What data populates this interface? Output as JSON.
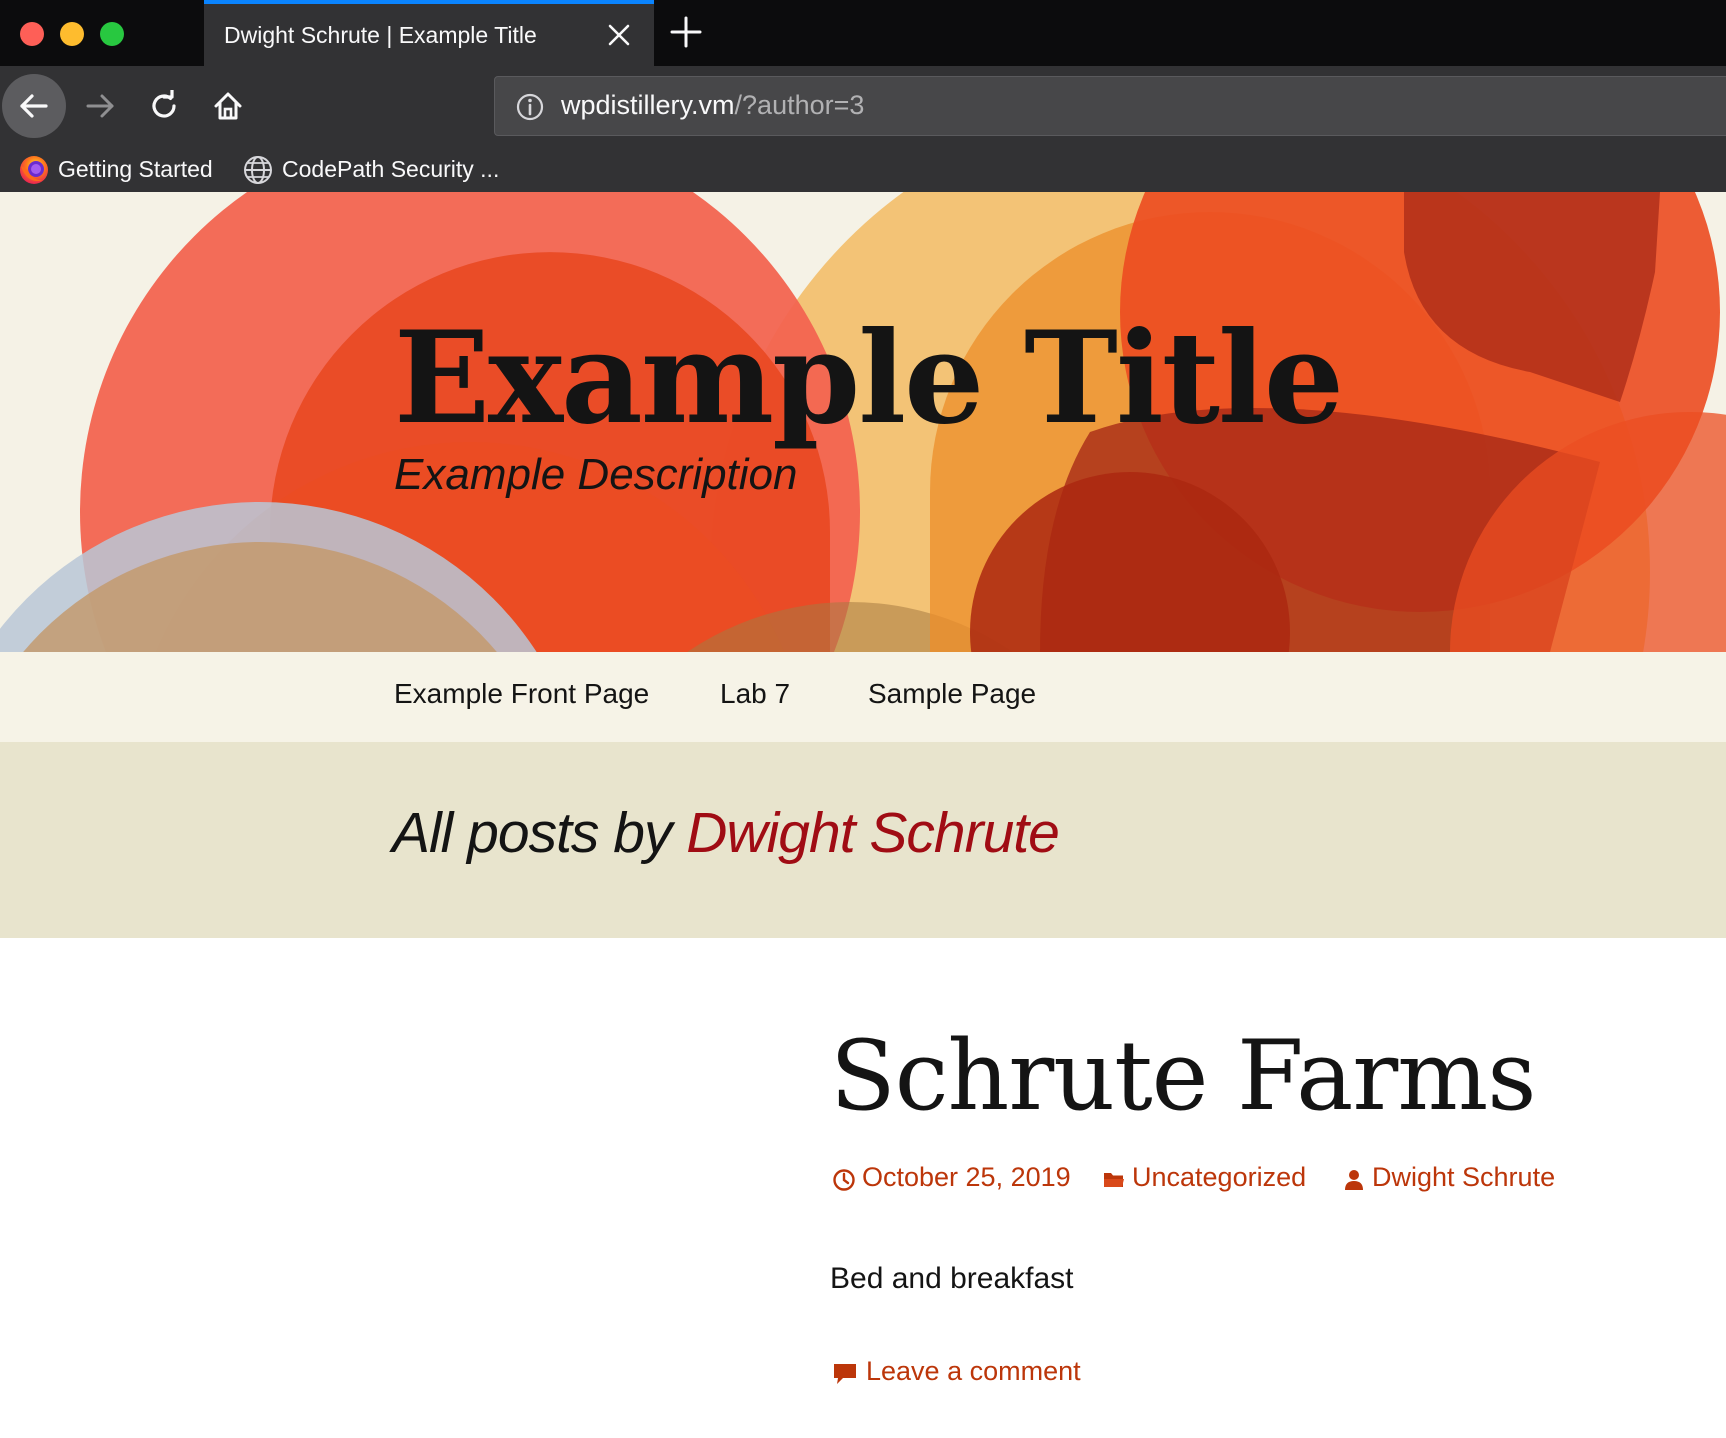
{
  "browser": {
    "tab": {
      "title": "Dwight Schrute | Example Title"
    },
    "url": {
      "host": "wpdistillery.vm",
      "path": "/?author=3"
    },
    "bookmarks": [
      {
        "label": "Getting Started",
        "icon": "firefox-icon"
      },
      {
        "label": "CodePath Security ...",
        "icon": "globe-icon"
      }
    ]
  },
  "site": {
    "title": "Example Title",
    "description": "Example Description"
  },
  "menu": {
    "items": [
      {
        "label": "Example Front Page"
      },
      {
        "label": "Lab 7"
      },
      {
        "label": "Sample Page"
      }
    ]
  },
  "archive": {
    "prefix": "All posts by ",
    "author": "Dwight Schrute"
  },
  "post": {
    "title": "Schrute Farms",
    "date": "October 25, 2019",
    "category": "Uncategorized",
    "author": "Dwight Schrute",
    "excerpt": "Bed and breakfast",
    "comment_link": "Leave a comment"
  },
  "colors": {
    "accent": "#bc360a",
    "archive_author": "#a00c14",
    "tab_highlight": "#0a84ff"
  }
}
